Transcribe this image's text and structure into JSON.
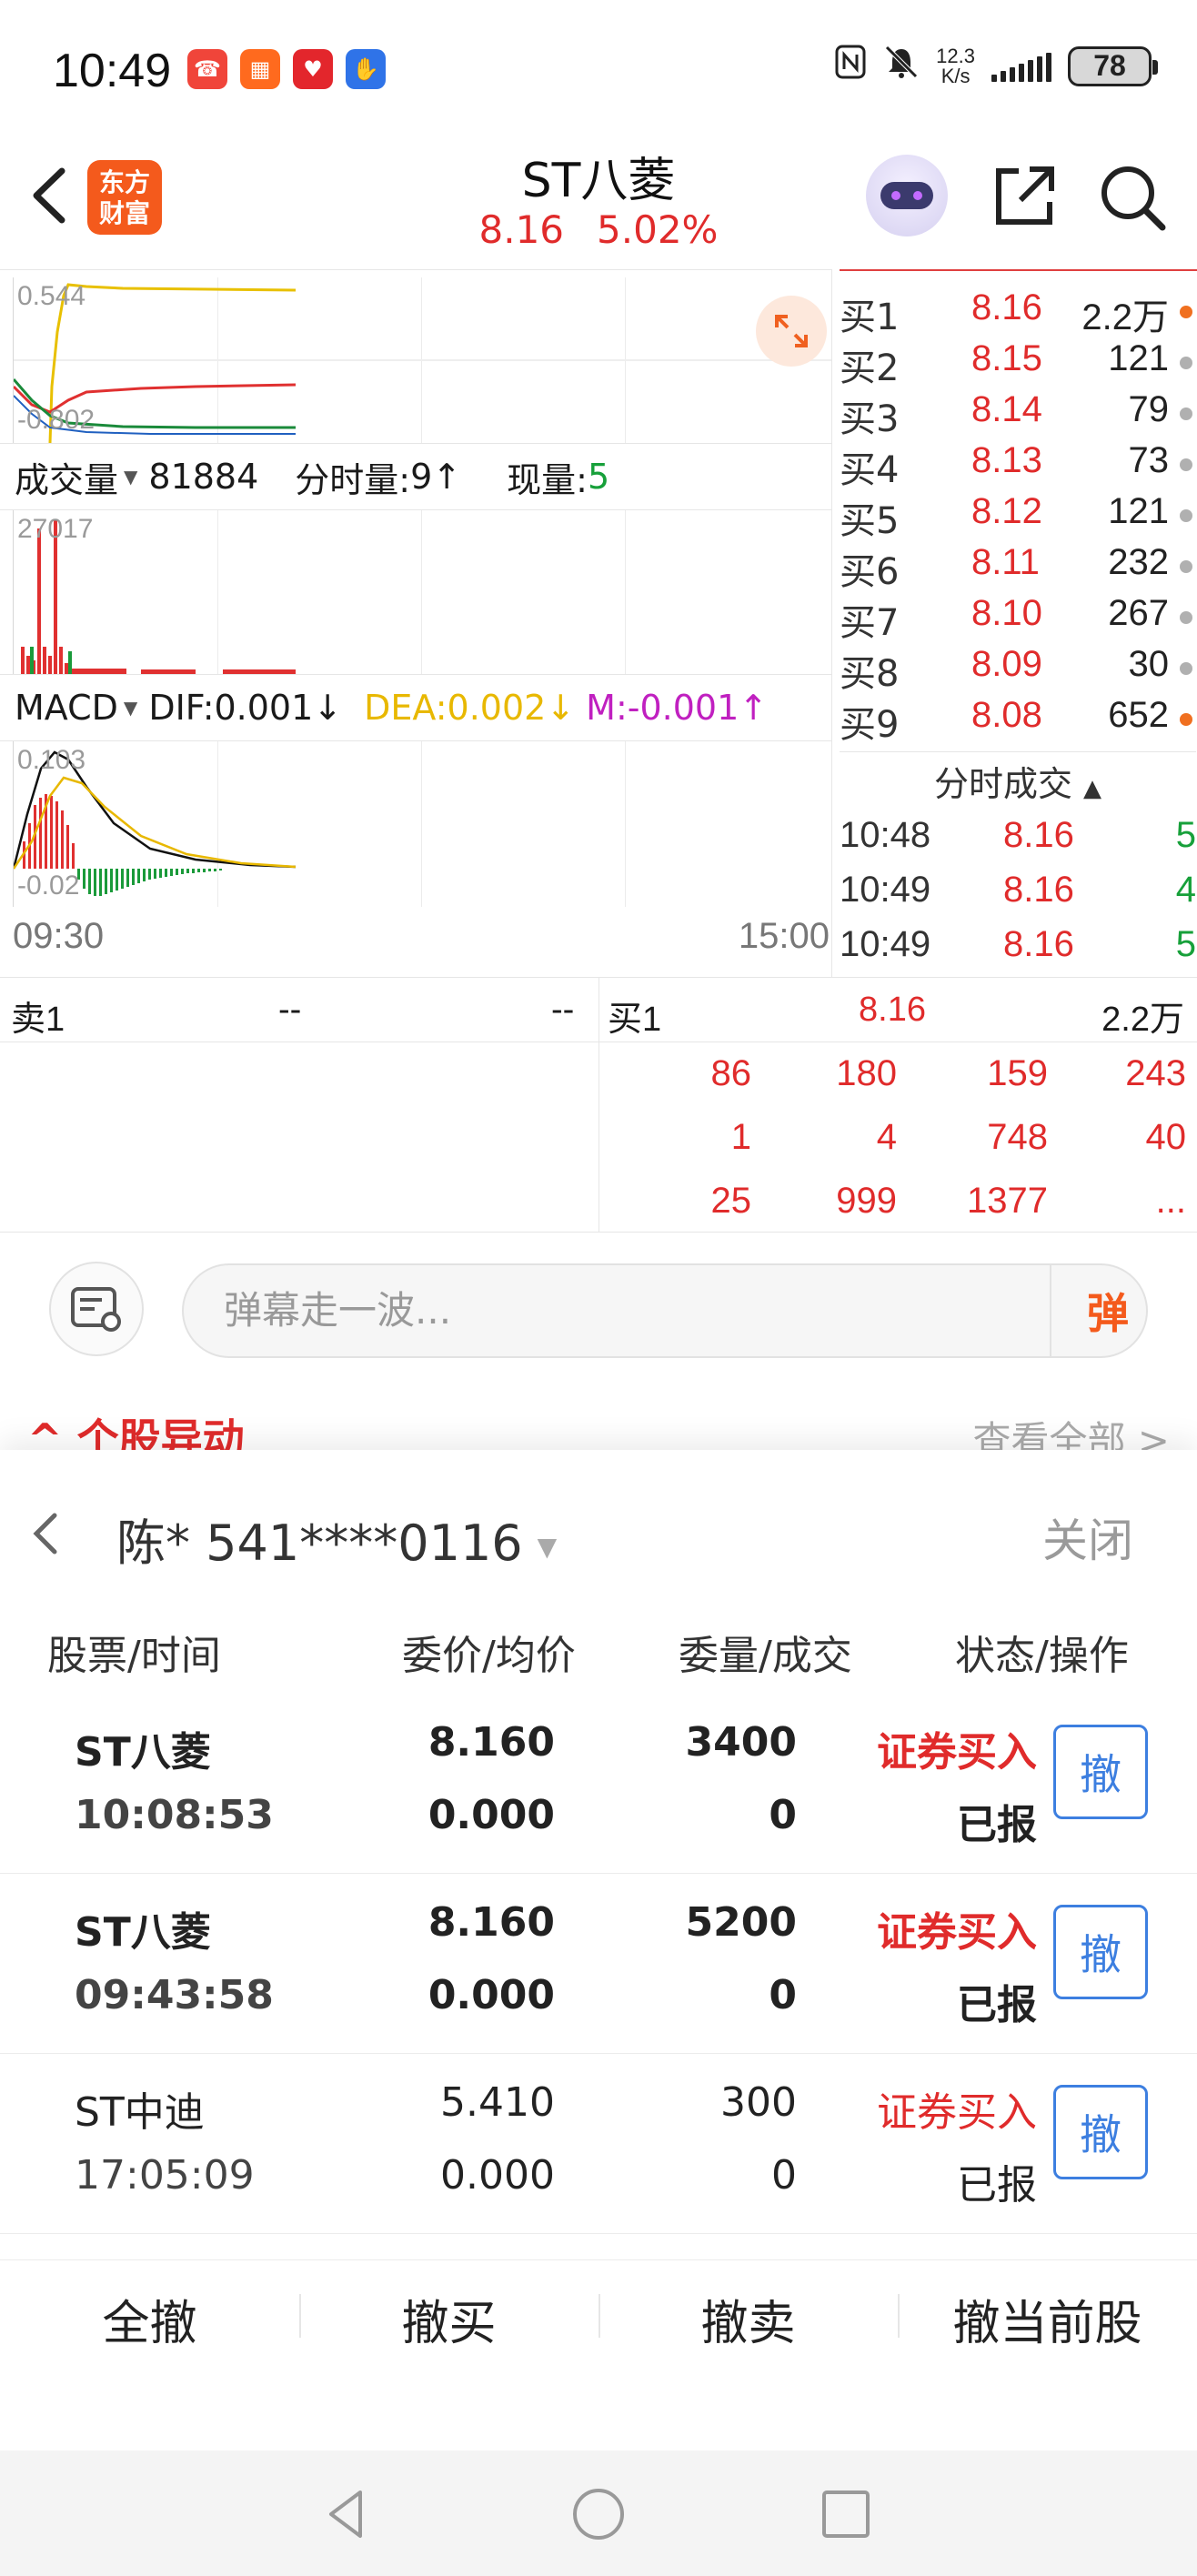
{
  "status_bar": {
    "time": "10:49",
    "net_speed_value": "12.3",
    "net_speed_unit": "K/s",
    "battery": "78",
    "app_icons": [
      "phone-app-icon",
      "grid-app-icon",
      "heart-app-icon",
      "hand-app-icon"
    ],
    "right_icons": [
      "nfc-icon",
      "mute-icon",
      "signal-icon",
      "battery-icon"
    ]
  },
  "header": {
    "brand_line1": "东方",
    "brand_line2": "财富",
    "stock_name": "ST八菱",
    "price": "8.16",
    "change_pct": "5.02%"
  },
  "chart": {
    "price_axis": {
      "max": "0.544",
      "min": "-0.802"
    },
    "volume_indicator": {
      "selector": "成交量",
      "value": "81884",
      "minute_label": "分时量:",
      "minute_value": "9",
      "minute_arrow": "↑",
      "current_label": "现量:",
      "current_value": "5",
      "axis_max": "27017"
    },
    "macd_indicator": {
      "selector": "MACD",
      "dif": "DIF:0.001",
      "dif_arrow": "↓",
      "dea": "DEA:0.002",
      "dea_arrow": "↓",
      "m": "M:-0.001",
      "m_arrow": "↑",
      "axis_max": "0.103",
      "axis_min": "-0.02"
    },
    "time_start": "09:30",
    "time_end": "15:00"
  },
  "order_book": {
    "bids": [
      {
        "label": "买1",
        "price": "8.16",
        "volume": "2.2万",
        "dot": "#f07020"
      },
      {
        "label": "买2",
        "price": "8.15",
        "volume": "121",
        "dot": "#b0b0b0"
      },
      {
        "label": "买3",
        "price": "8.14",
        "volume": "79",
        "dot": "#b0b0b0"
      },
      {
        "label": "买4",
        "price": "8.13",
        "volume": "73",
        "dot": "#b0b0b0"
      },
      {
        "label": "买5",
        "price": "8.12",
        "volume": "121",
        "dot": "#b0b0b0"
      },
      {
        "label": "买6",
        "price": "8.11",
        "volume": "232",
        "dot": "#b0b0b0"
      },
      {
        "label": "买7",
        "price": "8.10",
        "volume": "267",
        "dot": "#b0b0b0"
      },
      {
        "label": "买8",
        "price": "8.09",
        "volume": "30",
        "dot": "#b0b0b0"
      },
      {
        "label": "买9",
        "price": "8.08",
        "volume": "652",
        "dot": "#f07020"
      }
    ],
    "ticks_title": "分时成交",
    "ticks": [
      {
        "time": "10:48",
        "price": "8.16",
        "vol": "5"
      },
      {
        "time": "10:49",
        "price": "8.16",
        "vol": "4"
      },
      {
        "time": "10:49",
        "price": "8.16",
        "vol": "5"
      }
    ]
  },
  "level": {
    "sell_label": "卖1",
    "sell_price": "--",
    "sell_vol": "--",
    "buy_label": "买1",
    "buy_price": "8.16",
    "buy_vol": "2.2万",
    "queue": [
      [
        "86",
        "180",
        "159",
        "243"
      ],
      [
        "1",
        "4",
        "748",
        "40"
      ],
      [
        "25",
        "999",
        "1377",
        "..."
      ]
    ]
  },
  "danmaku": {
    "placeholder": "弹幕走一波...",
    "send_label": "弹"
  },
  "peek": {
    "left": "个股异动",
    "right": "查看全部"
  },
  "sheet": {
    "account": "陈* 541****0116",
    "close_label": "关闭",
    "columns": [
      "股票/时间",
      "委价/均价",
      "委量/成交",
      "状态/操作"
    ],
    "orders": [
      {
        "name": "ST八菱",
        "time": "10:08:53",
        "price": "8.160",
        "avg": "0.000",
        "qty": "3400",
        "filled": "0",
        "type": "证券买入",
        "status": "已报",
        "cancel": "撤"
      },
      {
        "name": "ST八菱",
        "time": "09:43:58",
        "price": "8.160",
        "avg": "0.000",
        "qty": "5200",
        "filled": "0",
        "type": "证券买入",
        "status": "已报",
        "cancel": "撤"
      },
      {
        "name": "ST中迪",
        "time": "17:05:09",
        "price": "5.410",
        "avg": "0.000",
        "qty": "300",
        "filled": "0",
        "type": "证券买入",
        "status": "已报",
        "cancel": "撤"
      }
    ],
    "actions": [
      "全撤",
      "撤买",
      "撤卖",
      "撤当前股"
    ]
  },
  "colors": {
    "up_red": "#e02b2b",
    "down_green": "#17a03a",
    "brand_orange": "#f45a1c",
    "cancel_blue": "#3d7fe0",
    "dea_yellow": "#e8b800",
    "m_magenta": "#c020c0"
  }
}
